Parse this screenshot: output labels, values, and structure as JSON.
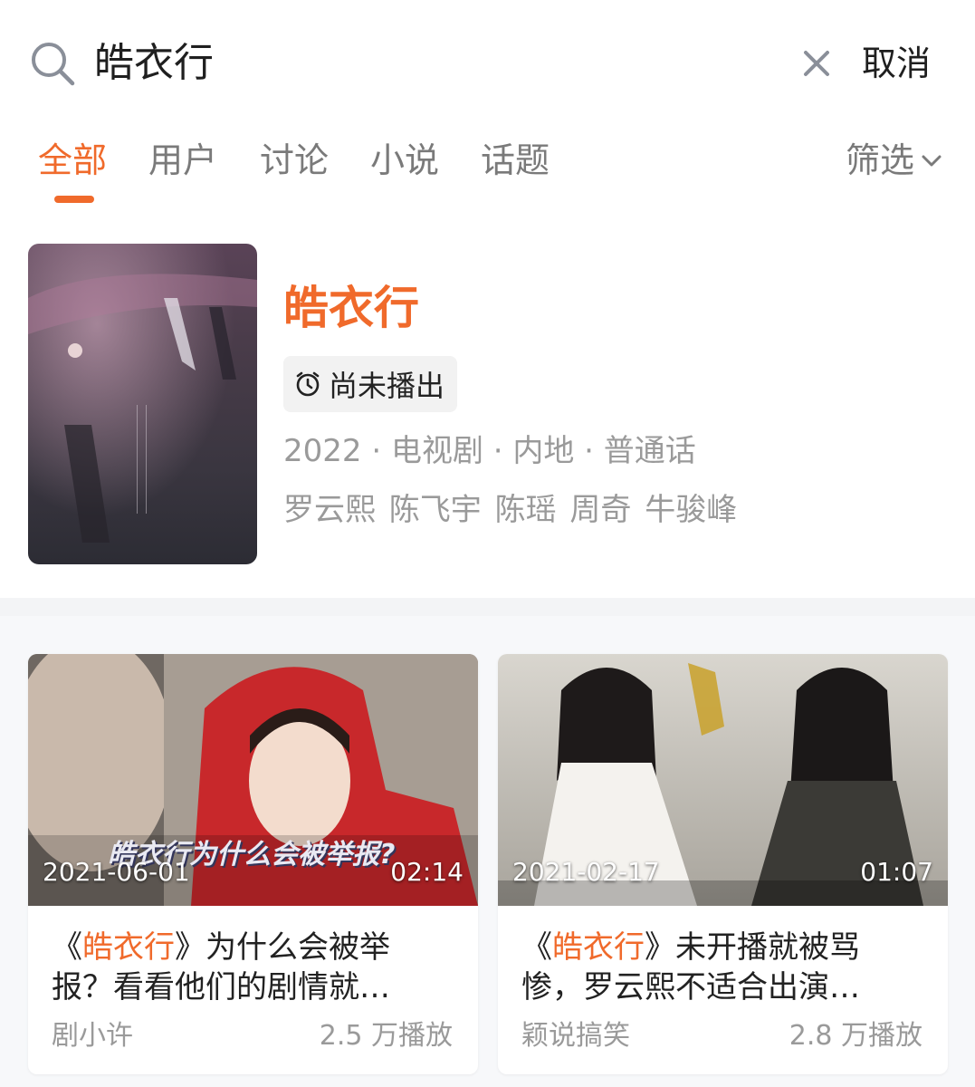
{
  "search": {
    "query": "皓衣行",
    "cancel_label": "取消",
    "icon": "search-icon",
    "clear_icon": "close-icon"
  },
  "tabs": {
    "items": [
      {
        "label": "全部",
        "active": true
      },
      {
        "label": "用户",
        "active": false
      },
      {
        "label": "讨论",
        "active": false
      },
      {
        "label": "小说",
        "active": false
      },
      {
        "label": "话题",
        "active": false
      }
    ],
    "filter_label": "筛选"
  },
  "show": {
    "title": "皓衣行",
    "status": "尚未播出",
    "meta": "2022 · 电视剧 · 内地 · 普通话",
    "cast": "罗云熙 陈飞宇 陈瑶 周奇 牛骏峰"
  },
  "videos": [
    {
      "date": "2021-06-01",
      "duration": "02:14",
      "caption": "皓衣行为什么会被举报?",
      "title_prefix": "《",
      "title_highlight": "皓衣行",
      "title_line1_rest": "》为什么会被举",
      "title_line2": "报？看看他们的剧情就…",
      "author": "剧小许",
      "views": "2.5 万播放"
    },
    {
      "date": "2021-02-17",
      "duration": "01:07",
      "title_prefix": "《",
      "title_highlight": "皓衣行",
      "title_line1_rest": "》未开播就被骂",
      "title_line2": "惨，罗云熙不适合出演…",
      "author": "颖说搞笑",
      "views": "2.8 万播放"
    }
  ],
  "colors": {
    "accent": "#f06a2b",
    "muted": "#9a9a9a",
    "text": "#222222"
  }
}
